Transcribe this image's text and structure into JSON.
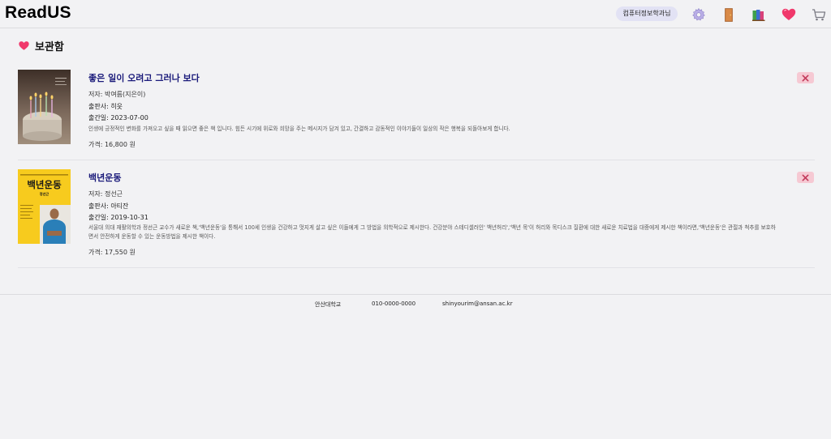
{
  "header": {
    "logo": "ReadUS",
    "user_badge": "컴퓨터정보학과님",
    "icons": [
      "gear-icon",
      "door-icon",
      "books-icon",
      "heart-icon",
      "cart-icon"
    ]
  },
  "section": {
    "icon": "heart-icon",
    "title": "보관함"
  },
  "items": [
    {
      "title": "좋은 일이 오려고 그러나 보다",
      "author": "저자: 박여름(지은이)",
      "publisher": "출판사: 히읏",
      "pubdate": "출간일: 2023-07-00",
      "description": "인생에 긍정적인 변화를 가져오고 싶을 때 읽으면 좋은 책 입니다. 힘든 시기에 위로와 희망을 주는 메시지가 담겨 있고, 간결하고 감동적인 이야기들이 일상의 작은 행복을 되돌아보게 합니다.",
      "price": "가격: 16,800 원",
      "cover_icon": "book-cover-cake"
    },
    {
      "title": "백년운동",
      "author": "저자: 정선근",
      "publisher": "출판사: 아티잔",
      "pubdate": "출간일: 2019-10-31",
      "description": "서울대 의대 재활의학과 정선근 교수가 새로운 책,'백년운동'을 통해서 100세 인생을 건강하고 멋지게 살고 싶은 이들에게 그 방법을 의학적으로 제시한다. 건강분야 스테디셀러인' 백년허리','백년 목'이 허리와 목디스크 질환에 대한 새로운 치료법을 대중에게 제시한 책이라면,'백년운동'은 관절과 척추를 보호하면서 안전하게 운동할 수 있는 운동방법을 제시한 책이다.",
      "price": "가격: 17,550 원",
      "cover_title": "백년운동",
      "cover_author": "정선근",
      "cover_icon": "book-cover-yellow"
    }
  ],
  "footer": {
    "school": "안산대학교",
    "phone": "010-0000-0000",
    "email": "shinyourim@ansan.ac.kr"
  },
  "colors": {
    "background": "#f2f2f4",
    "title": "#1a1a7a",
    "remove_button": "#f6c9d3",
    "badge": "#e2e2f4"
  }
}
